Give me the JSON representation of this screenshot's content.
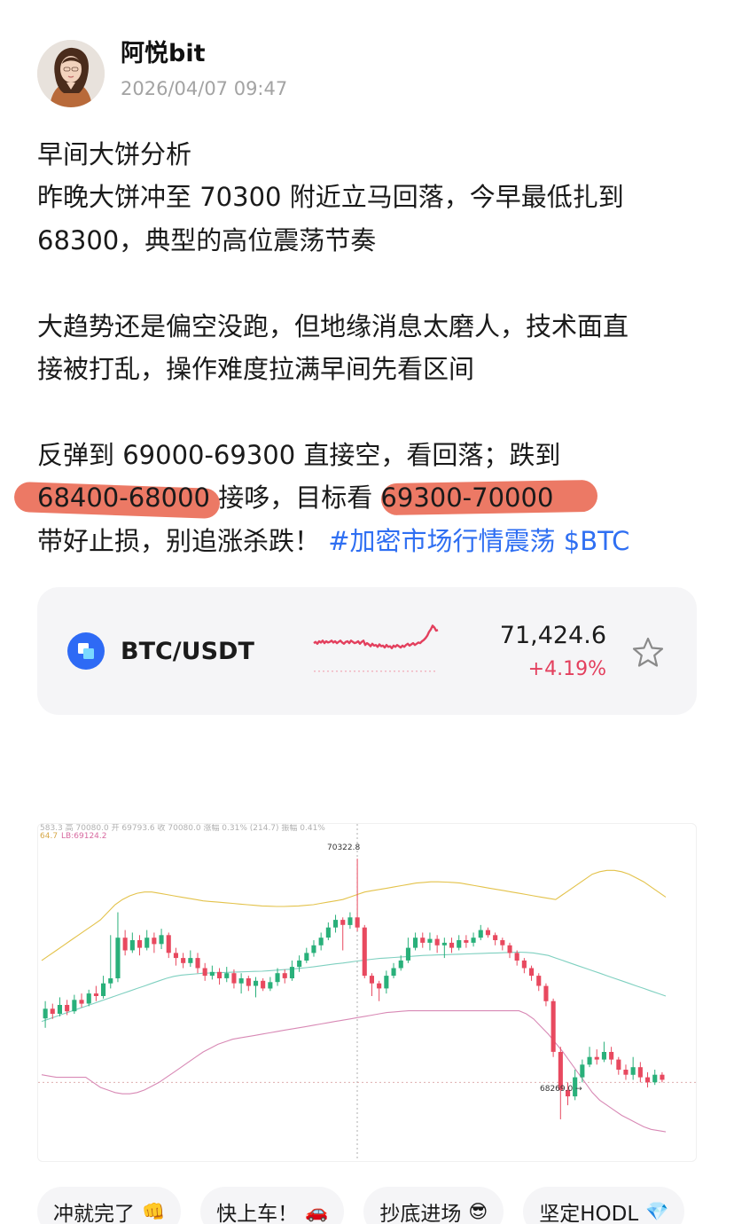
{
  "author": {
    "name": "阿悦bit",
    "time": "2026/04/07 09:47"
  },
  "post": {
    "lines": [
      "早间大饼分析",
      "昨晚大饼冲至 70300 附近立马回落，今早最低扎到",
      "68300，典型的高位震荡节奏",
      "",
      "大趋势还是偏空没跑，但地缘消息太磨人，技术面直",
      "接被打乱，操作难度拉满早间先看区间",
      "",
      "反弹到 69000-69300 直接空，看回落；跌到"
    ],
    "line9": {
      "range_a": "68400-68000",
      "mid": " 接哆，目标看 ",
      "range_b": "69300-70000"
    },
    "line10": {
      "text": "带好止损，别追涨杀跌！",
      "tag": "#加密市场行情震荡",
      "cashtag": "$BTC"
    }
  },
  "ticker": {
    "pair": "BTC/USDT",
    "price": "71,424.6",
    "change": "+4.19%",
    "change_color": "#e33f5d",
    "spark": [
      0.3,
      0.28,
      0.31,
      0.27,
      0.29,
      0.26,
      0.3,
      0.27,
      0.29,
      0.28,
      0.26,
      0.29,
      0.27,
      0.3,
      0.28,
      0.26,
      0.29,
      0.31,
      0.28,
      0.27,
      0.3,
      0.26,
      0.28,
      0.3,
      0.29,
      0.27,
      0.31,
      0.28,
      0.26,
      0.33,
      0.3,
      0.32,
      0.35,
      0.31,
      0.34,
      0.33,
      0.36,
      0.32,
      0.35,
      0.34,
      0.37,
      0.33,
      0.36,
      0.35,
      0.38,
      0.34,
      0.36,
      0.33,
      0.35,
      0.37,
      0.34,
      0.36,
      0.33,
      0.31,
      0.34,
      0.32,
      0.3,
      0.33,
      0.31,
      0.29,
      0.3,
      0.27,
      0.25,
      0.22,
      0.18,
      0.12,
      0.08,
      0.02,
      0.05,
      0.1,
      0.09
    ]
  },
  "chart": {
    "header_text": "583.3 高 70080.0 开 69793.6 收 70080.0 涨幅 0.31% (214.7) 振幅 0.41%",
    "mb_text": "64.7",
    "lb_text": "LB:69124.2",
    "high_label": "70322.8",
    "low_label": "68269.0",
    "colors": {
      "up": "#29b07a",
      "down": "#e8495f",
      "upper_band": "#e3c24a",
      "mid_band": "#7fd0c0",
      "lower_band": "#d889b5"
    }
  },
  "chart_data": {
    "type": "candlestick",
    "annotations": [
      "70322.8",
      "68269.0"
    ],
    "bands": [
      "upper",
      "mid",
      "LB:69124.2"
    ],
    "candles": [
      [
        69064,
        69140,
        69200,
        68990
      ],
      [
        69140,
        69100,
        69180,
        69060
      ],
      [
        69100,
        69170,
        69230,
        69080
      ],
      [
        69170,
        69120,
        69210,
        69090
      ],
      [
        69120,
        69210,
        69250,
        69100
      ],
      [
        69210,
        69180,
        69260,
        69150
      ],
      [
        69180,
        69260,
        69290,
        69160
      ],
      [
        69260,
        69240,
        69320,
        69200
      ],
      [
        69240,
        69340,
        69400,
        69220
      ],
      [
        69340,
        69380,
        69720,
        69300
      ],
      [
        69380,
        69700,
        69900,
        69350
      ],
      [
        69700,
        69600,
        69760,
        69560
      ],
      [
        69600,
        69680,
        69740,
        69580
      ],
      [
        69680,
        69620,
        69720,
        69560
      ],
      [
        69620,
        69700,
        69760,
        69600
      ],
      [
        69700,
        69650,
        69740,
        69580
      ],
      [
        69650,
        69720,
        69770,
        69610
      ],
      [
        69720,
        69580,
        69740,
        69540
      ],
      [
        69580,
        69540,
        69620,
        69480
      ],
      [
        69540,
        69500,
        69580,
        69460
      ],
      [
        69500,
        69540,
        69600,
        69470
      ],
      [
        69540,
        69460,
        69580,
        69420
      ],
      [
        69460,
        69400,
        69500,
        69360
      ],
      [
        69400,
        69430,
        69480,
        69370
      ],
      [
        69430,
        69380,
        69460,
        69330
      ],
      [
        69380,
        69420,
        69470,
        69350
      ],
      [
        69420,
        69340,
        69450,
        69300
      ],
      [
        69340,
        69380,
        69420,
        69260
      ],
      [
        69380,
        69320,
        69400,
        69280
      ],
      [
        69320,
        69360,
        69390,
        69230
      ],
      [
        69360,
        69300,
        69380,
        69280
      ],
      [
        69300,
        69350,
        69390,
        69280
      ],
      [
        69350,
        69420,
        69460,
        69320
      ],
      [
        69420,
        69380,
        69450,
        69340
      ],
      [
        69380,
        69470,
        69520,
        69360
      ],
      [
        69470,
        69520,
        69560,
        69430
      ],
      [
        69520,
        69580,
        69620,
        69500
      ],
      [
        69580,
        69640,
        69680,
        69550
      ],
      [
        69640,
        69700,
        69740,
        69600
      ],
      [
        69700,
        69780,
        69820,
        69680
      ],
      [
        69780,
        69840,
        69880,
        69740
      ],
      [
        69840,
        69800,
        69860,
        69600
      ],
      [
        69800,
        69860,
        69900,
        69770
      ],
      [
        69860,
        69780,
        70322,
        69750
      ],
      [
        69780,
        69400,
        69800,
        69380
      ],
      [
        69400,
        69340,
        69420,
        69240
      ],
      [
        69340,
        69300,
        69360,
        69200
      ],
      [
        69300,
        69400,
        69440,
        69260
      ],
      [
        69400,
        69460,
        69500,
        69380
      ],
      [
        69460,
        69520,
        69560,
        69440
      ],
      [
        69520,
        69620,
        69700,
        69500
      ],
      [
        69620,
        69700,
        69740,
        69600
      ],
      [
        69700,
        69660,
        69740,
        69620
      ],
      [
        69660,
        69690,
        69740,
        69600
      ],
      [
        69690,
        69640,
        69720,
        69580
      ],
      [
        69640,
        69660,
        69700,
        69540
      ],
      [
        69660,
        69620,
        69700,
        69580
      ],
      [
        69620,
        69680,
        69720,
        69600
      ],
      [
        69680,
        69660,
        69720,
        69620
      ],
      [
        69660,
        69700,
        69740,
        69630
      ],
      [
        69700,
        69760,
        69800,
        69680
      ],
      [
        69760,
        69720,
        69780,
        69700
      ],
      [
        69720,
        69680,
        69740,
        69640
      ],
      [
        69680,
        69640,
        69700,
        69600
      ],
      [
        69640,
        69580,
        69660,
        69540
      ],
      [
        69580,
        69520,
        69600,
        69480
      ],
      [
        69520,
        69460,
        69540,
        69420
      ],
      [
        69460,
        69400,
        69480,
        69360
      ],
      [
        69400,
        69320,
        69420,
        69280
      ],
      [
        69320,
        69200,
        69340,
        69160
      ],
      [
        69200,
        68800,
        69220,
        68760
      ],
      [
        68800,
        68500,
        68840,
        68269
      ],
      [
        68500,
        68450,
        68560,
        68380
      ],
      [
        68450,
        68600,
        68660,
        68420
      ],
      [
        68600,
        68700,
        68740,
        68560
      ],
      [
        68700,
        68760,
        68840,
        68680
      ],
      [
        68760,
        68740,
        68820,
        68700
      ],
      [
        68740,
        68800,
        68880,
        68720
      ],
      [
        68800,
        68740,
        68840,
        68700
      ],
      [
        68740,
        68660,
        68760,
        68620
      ],
      [
        68660,
        68620,
        68700,
        68580
      ],
      [
        68620,
        68680,
        68760,
        68580
      ],
      [
        68680,
        68600,
        68720,
        68560
      ],
      [
        68600,
        68560,
        68640,
        68520
      ],
      [
        68560,
        68620,
        68660,
        68540
      ],
      [
        68620,
        68580,
        68640,
        68560
      ]
    ],
    "upper_band": [
      69520,
      69560,
      69600,
      69640,
      69680,
      69720,
      69760,
      69800,
      69840,
      69900,
      69960,
      70000,
      70030,
      70050,
      70060,
      70060,
      70050,
      70040,
      70030,
      70020,
      70010,
      70000,
      69990,
      69985,
      69980,
      69975,
      69970,
      69965,
      69960,
      69955,
      69950,
      69948,
      69946,
      69946,
      69948,
      69950,
      69955,
      69960,
      69970,
      69980,
      69990,
      70000,
      70020,
      70040,
      70060,
      70070,
      70080,
      70090,
      70100,
      70110,
      70120,
      70130,
      70135,
      70140,
      70140,
      70138,
      70135,
      70130,
      70120,
      70110,
      70100,
      70090,
      70080,
      70070,
      70060,
      70050,
      70040,
      70030,
      70020,
      70010,
      70000,
      70040,
      70080,
      70120,
      70160,
      70200,
      70220,
      70230,
      70230,
      70220,
      70200,
      70170,
      70140,
      70100,
      70060,
      70020
    ],
    "mid_band": [
      69040,
      69060,
      69080,
      69100,
      69120,
      69140,
      69160,
      69180,
      69200,
      69220,
      69240,
      69260,
      69280,
      69300,
      69320,
      69340,
      69360,
      69380,
      69395,
      69405,
      69410,
      69415,
      69420,
      69422,
      69424,
      69426,
      69428,
      69430,
      69432,
      69434,
      69436,
      69440,
      69444,
      69448,
      69452,
      69458,
      69464,
      69470,
      69478,
      69486,
      69494,
      69500,
      69508,
      69516,
      69524,
      69530,
      69536,
      69540,
      69544,
      69548,
      69552,
      69556,
      69560,
      69562,
      69564,
      69566,
      69568,
      69570,
      69572,
      69574,
      69576,
      69578,
      69580,
      69582,
      69584,
      69586,
      69584,
      69580,
      69570,
      69560,
      69540,
      69520,
      69500,
      69480,
      69460,
      69440,
      69420,
      69400,
      69380,
      69360,
      69340,
      69320,
      69300,
      69280,
      69260,
      69240
    ],
    "lower_band": [
      68620,
      68610,
      68600,
      68600,
      68600,
      68600,
      68600,
      68560,
      68520,
      68500,
      68480,
      68470,
      68470,
      68480,
      68500,
      68530,
      68560,
      68600,
      68640,
      68680,
      68720,
      68760,
      68800,
      68830,
      68860,
      68880,
      68900,
      68910,
      68920,
      68930,
      68940,
      68950,
      68960,
      68970,
      68980,
      68990,
      69000,
      69010,
      69020,
      69030,
      69040,
      69050,
      69060,
      69070,
      69080,
      69090,
      69100,
      69110,
      69115,
      69120,
      69124,
      69124,
      69124,
      69124,
      69124,
      69124,
      69124,
      69124,
      69124,
      69124,
      69124,
      69124,
      69124,
      69124,
      69124,
      69124,
      69100,
      69060,
      69000,
      68940,
      68870,
      68800,
      68720,
      68640,
      68560,
      68480,
      68420,
      68380,
      68340,
      68300,
      68270,
      68240,
      68210,
      68190,
      68180,
      68170
    ]
  },
  "reactions": [
    {
      "label": "冲就完了",
      "emoji": "👊"
    },
    {
      "label": "快上车！",
      "emoji": "🚗"
    },
    {
      "label": "抄底进场",
      "emoji": "😎"
    },
    {
      "label": "坚定HODL",
      "emoji": "💎"
    }
  ]
}
